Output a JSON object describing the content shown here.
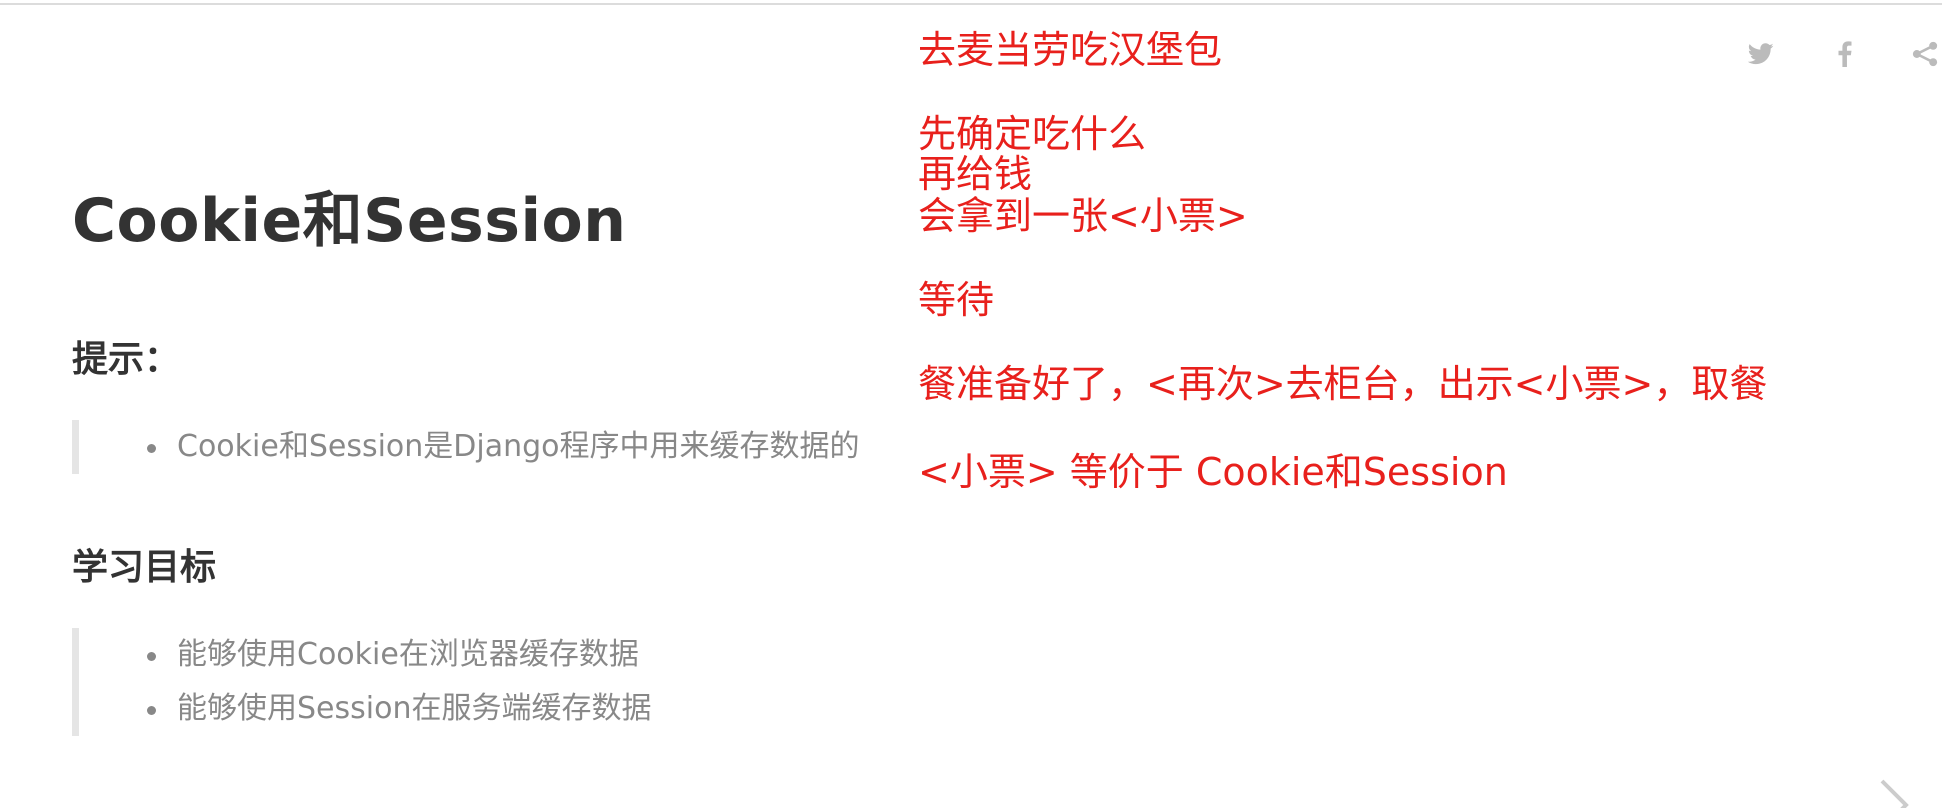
{
  "page": {
    "title": "Cookie和Session"
  },
  "hint": {
    "heading": "提示：",
    "items": [
      "Cookie和Session是Django程序中用来缓存数据的"
    ]
  },
  "goals": {
    "heading": "学习目标",
    "items": [
      "能够使用Cookie在浏览器缓存数据",
      "能够使用Session在服务端缓存数据"
    ]
  },
  "annotation": {
    "lines": [
      "去麦当劳吃汉堡包",
      "先确定吃什么",
      "再给钱",
      "会拿到一张<小票>",
      "等待",
      "餐准备好了，<再次>去柜台，出示<小票>，取餐",
      "<小票> 等价于 Cookie和Session"
    ],
    "color": "#e8201c"
  },
  "share": {
    "icons": [
      "twitter-icon",
      "facebook-icon",
      "share-icon"
    ],
    "color": "#bbbbbb"
  },
  "nav": {
    "next_icon": "chevron-right-icon"
  }
}
